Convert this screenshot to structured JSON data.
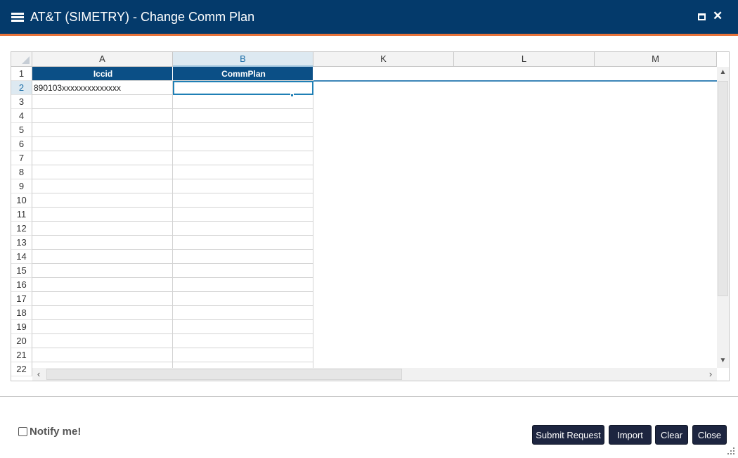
{
  "window": {
    "title": "AT&T (SIMETRY) - Change Comm Plan",
    "icons": {
      "app": "menu-lines-icon",
      "maximize": "maximize-icon",
      "close": "close-icon"
    },
    "close_glyph": "✕"
  },
  "sheet": {
    "columns": [
      "A",
      "B",
      "K",
      "L",
      "M"
    ],
    "selected_column": "B",
    "header_row": {
      "row": "1",
      "cells": [
        "Iccid",
        "CommPlan"
      ]
    },
    "rows": [
      {
        "n": "2",
        "a": "890103xxxxxxxxxxxxxx",
        "b": ""
      },
      {
        "n": "3",
        "a": "",
        "b": ""
      },
      {
        "n": "4",
        "a": "",
        "b": ""
      },
      {
        "n": "5",
        "a": "",
        "b": ""
      },
      {
        "n": "6",
        "a": "",
        "b": ""
      },
      {
        "n": "7",
        "a": "",
        "b": ""
      },
      {
        "n": "8",
        "a": "",
        "b": ""
      },
      {
        "n": "9",
        "a": "",
        "b": ""
      },
      {
        "n": "10",
        "a": "",
        "b": ""
      },
      {
        "n": "11",
        "a": "",
        "b": ""
      },
      {
        "n": "12",
        "a": "",
        "b": ""
      },
      {
        "n": "13",
        "a": "",
        "b": ""
      },
      {
        "n": "14",
        "a": "",
        "b": ""
      },
      {
        "n": "15",
        "a": "",
        "b": ""
      },
      {
        "n": "16",
        "a": "",
        "b": ""
      },
      {
        "n": "17",
        "a": "",
        "b": ""
      },
      {
        "n": "18",
        "a": "",
        "b": ""
      },
      {
        "n": "19",
        "a": "",
        "b": ""
      },
      {
        "n": "20",
        "a": "",
        "b": ""
      },
      {
        "n": "21",
        "a": "",
        "b": ""
      },
      {
        "n": "22",
        "a": "",
        "b": ""
      }
    ],
    "selected_row": "2",
    "scroll_icons": {
      "up": "▲",
      "down": "▼",
      "left": "‹",
      "right": "›"
    }
  },
  "footer": {
    "notify_label": "Notify me!",
    "notify_checked": false,
    "buttons": {
      "submit": "Submit Request",
      "import": "Import",
      "clear": "Clear",
      "close": "Close"
    }
  },
  "colors": {
    "titlebar": "#043a6b",
    "accent_line": "#e8733a",
    "header_cell": "#0b4f86",
    "button": "#1d2540",
    "selection": "#1f7fb5"
  }
}
